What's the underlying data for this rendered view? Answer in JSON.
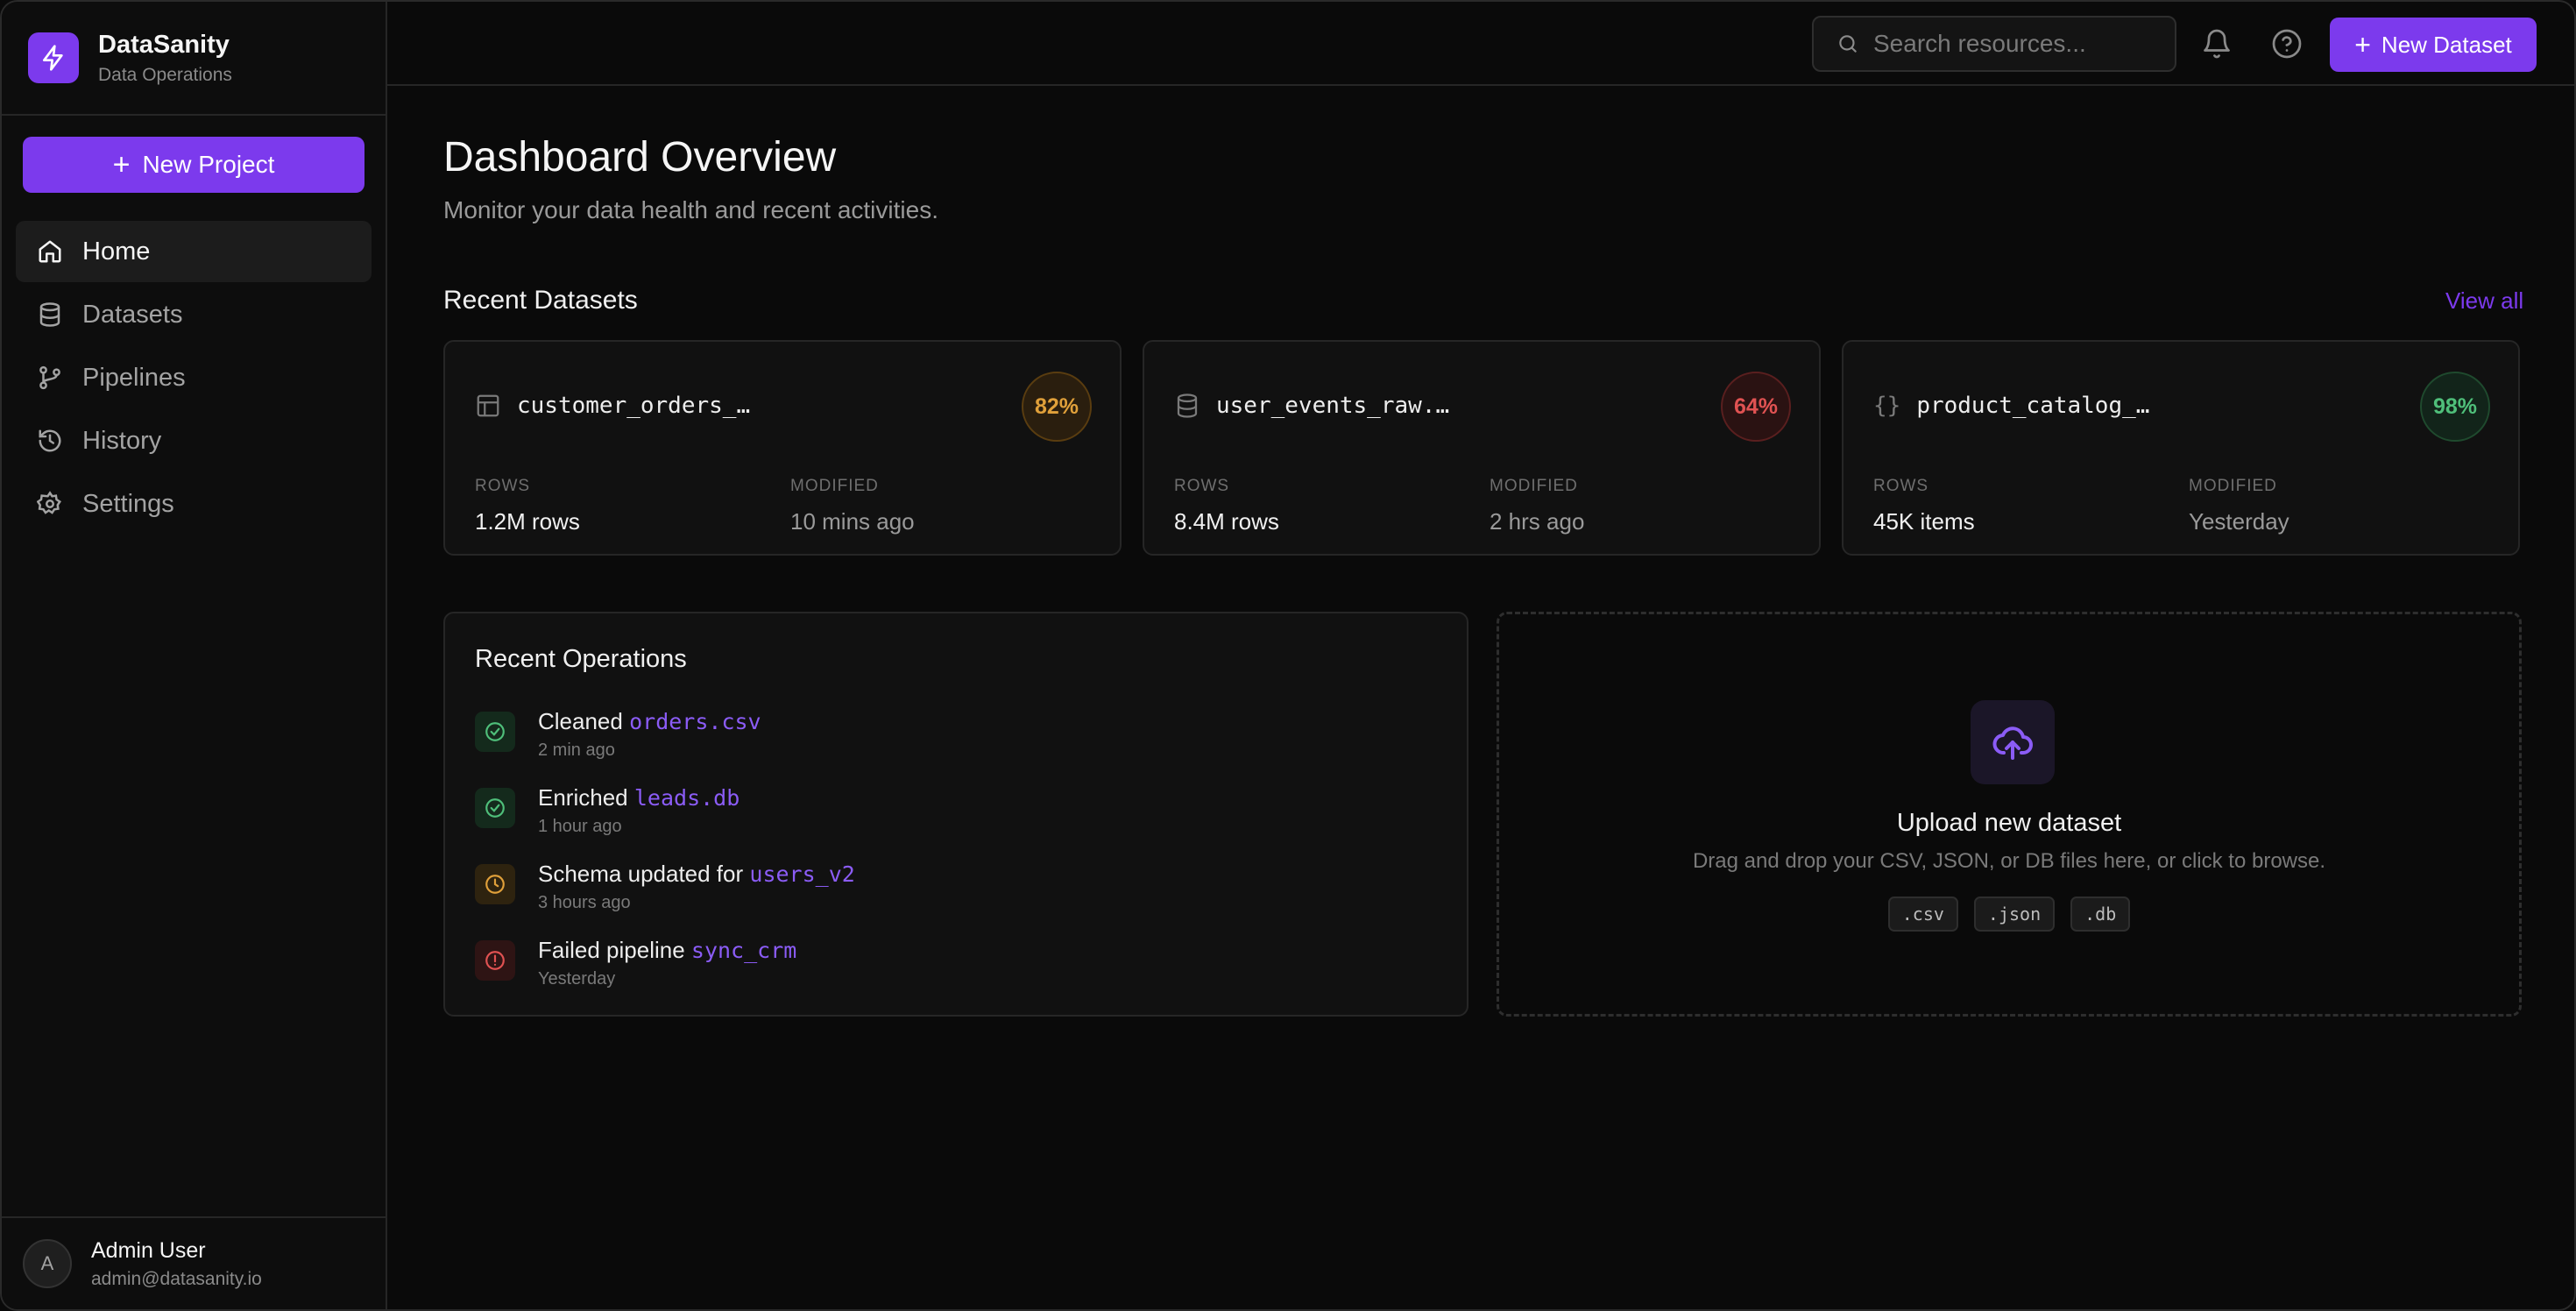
{
  "brand": {
    "name": "DataSanity",
    "subtitle": "Data Operations",
    "logo_icon": "lightning-icon",
    "accent": "#7c3aed"
  },
  "sidebar": {
    "new_project_label": "New Project",
    "items": [
      {
        "label": "Home",
        "icon": "home-icon",
        "active": true
      },
      {
        "label": "Datasets",
        "icon": "database-icon",
        "active": false
      },
      {
        "label": "Pipelines",
        "icon": "git-branch-icon",
        "active": false
      },
      {
        "label": "History",
        "icon": "history-icon",
        "active": false
      },
      {
        "label": "Settings",
        "icon": "gear-icon",
        "active": false
      }
    ]
  },
  "user": {
    "initial": "A",
    "name": "Admin User",
    "email": "admin@datasanity.io"
  },
  "topbar": {
    "search_placeholder": "Search resources...",
    "new_dataset_label": "New Dataset"
  },
  "main": {
    "title": "Dashboard Overview",
    "subtitle": "Monitor your data health and recent activities.",
    "recent_datasets_title": "Recent Datasets",
    "view_all_label": "View all"
  },
  "datasets": [
    {
      "name": "customer_orders_…",
      "icon": "table-icon",
      "score": "82%",
      "status": "amber",
      "rows_label": "ROWS",
      "rows": "1.2M rows",
      "modified_label": "MODIFIED",
      "modified": "10 mins ago"
    },
    {
      "name": "user_events_raw.…",
      "icon": "database-icon",
      "score": "64%",
      "status": "red",
      "rows_label": "ROWS",
      "rows": "8.4M rows",
      "modified_label": "MODIFIED",
      "modified": "2 hrs ago"
    },
    {
      "name": "product_catalog_…",
      "icon": "braces-icon",
      "score": "98%",
      "status": "green",
      "rows_label": "ROWS",
      "rows": "45K items",
      "modified_label": "MODIFIED",
      "modified": "Yesterday"
    }
  ],
  "operations": {
    "title": "Recent Operations",
    "items": [
      {
        "action": "Cleaned",
        "file": "orders.csv",
        "time": "2 min ago",
        "status": "success",
        "icon": "check-circle-icon"
      },
      {
        "action": "Enriched",
        "file": "leads.db",
        "time": "1 hour ago",
        "status": "success",
        "icon": "check-circle-icon"
      },
      {
        "action": "Schema updated for",
        "file": "users_v2",
        "time": "3 hours ago",
        "status": "pending",
        "icon": "clock-icon"
      },
      {
        "action": "Failed pipeline",
        "file": "sync_crm",
        "time": "Yesterday",
        "status": "error",
        "icon": "alert-circle-icon"
      }
    ]
  },
  "upload": {
    "title": "Upload new dataset",
    "description": "Drag and drop your CSV, JSON, or DB files here, or click to browse.",
    "extensions": [
      ".csv",
      ".json",
      ".db"
    ]
  },
  "colors": {
    "success": "#4fbf7a",
    "warning": "#e0a03a",
    "error": "#e05252",
    "link": "#8b5cf6"
  }
}
